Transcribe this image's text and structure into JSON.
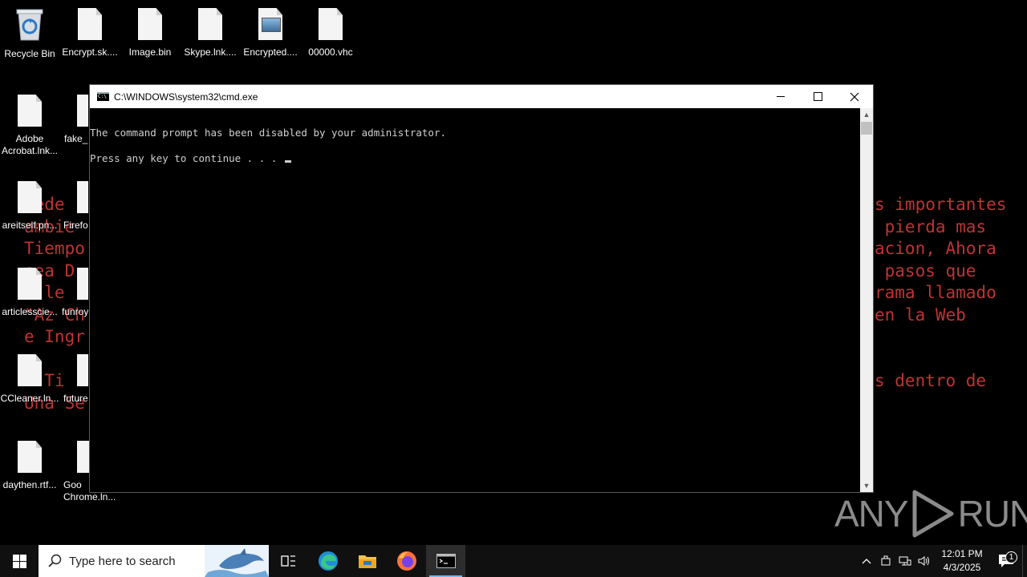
{
  "background_text": {
    "left": "uede\nambie\nTiempo\nsea D\ne le\n\"Az Ch\ne Ingr\n\n  Ti\nUna Se",
    "right": "s importantes\n pierda mas\nacion, Ahora\n pasos que\nrama llamado\nen la Web\n\n\ns dentro de"
  },
  "desktop_icons": [
    {
      "label": "Recycle Bin",
      "icon": "recycle-bin-icon"
    },
    {
      "label": "Encrypt.sk....",
      "icon": "file-icon"
    },
    {
      "label": "Image.bin",
      "icon": "file-icon"
    },
    {
      "label": "Skype.lnk....",
      "icon": "file-icon"
    },
    {
      "label": "Encrypted....",
      "icon": "image-file-icon"
    },
    {
      "label": "00000.vhc",
      "icon": "file-icon"
    },
    {
      "label": "Adobe Acrobat.lnk...",
      "icon": "file-icon"
    },
    {
      "label": "fake_l",
      "icon": "text-file-icon"
    },
    {
      "label": "areitself.pn...",
      "icon": "file-icon"
    },
    {
      "label": "Firefo",
      "icon": "file-icon"
    },
    {
      "label": "articlesscie...",
      "icon": "file-icon"
    },
    {
      "label": "funroy",
      "icon": "file-icon"
    },
    {
      "label": "CCleaner.ln...",
      "icon": "file-icon"
    },
    {
      "label": "future",
      "icon": "file-icon"
    },
    {
      "label": "daythen.rtf...",
      "icon": "file-icon"
    },
    {
      "label": "Goo Chrome.ln...",
      "icon": "file-icon"
    }
  ],
  "window": {
    "title": "C:\\WINDOWS\\system32\\cmd.exe",
    "lines": [
      "The command prompt has been disabled by your administrator.",
      "Press any key to continue . . . "
    ]
  },
  "watermark": {
    "left": "ANY",
    "right": "RUN"
  },
  "taskbar": {
    "search_placeholder": "Type here to search",
    "time": "12:01 PM",
    "date": "4/3/2025",
    "notification_count": "1",
    "pinned": [
      "task-view-icon",
      "edge-icon",
      "file-explorer-icon",
      "firefox-icon",
      "cmd-icon"
    ]
  }
}
